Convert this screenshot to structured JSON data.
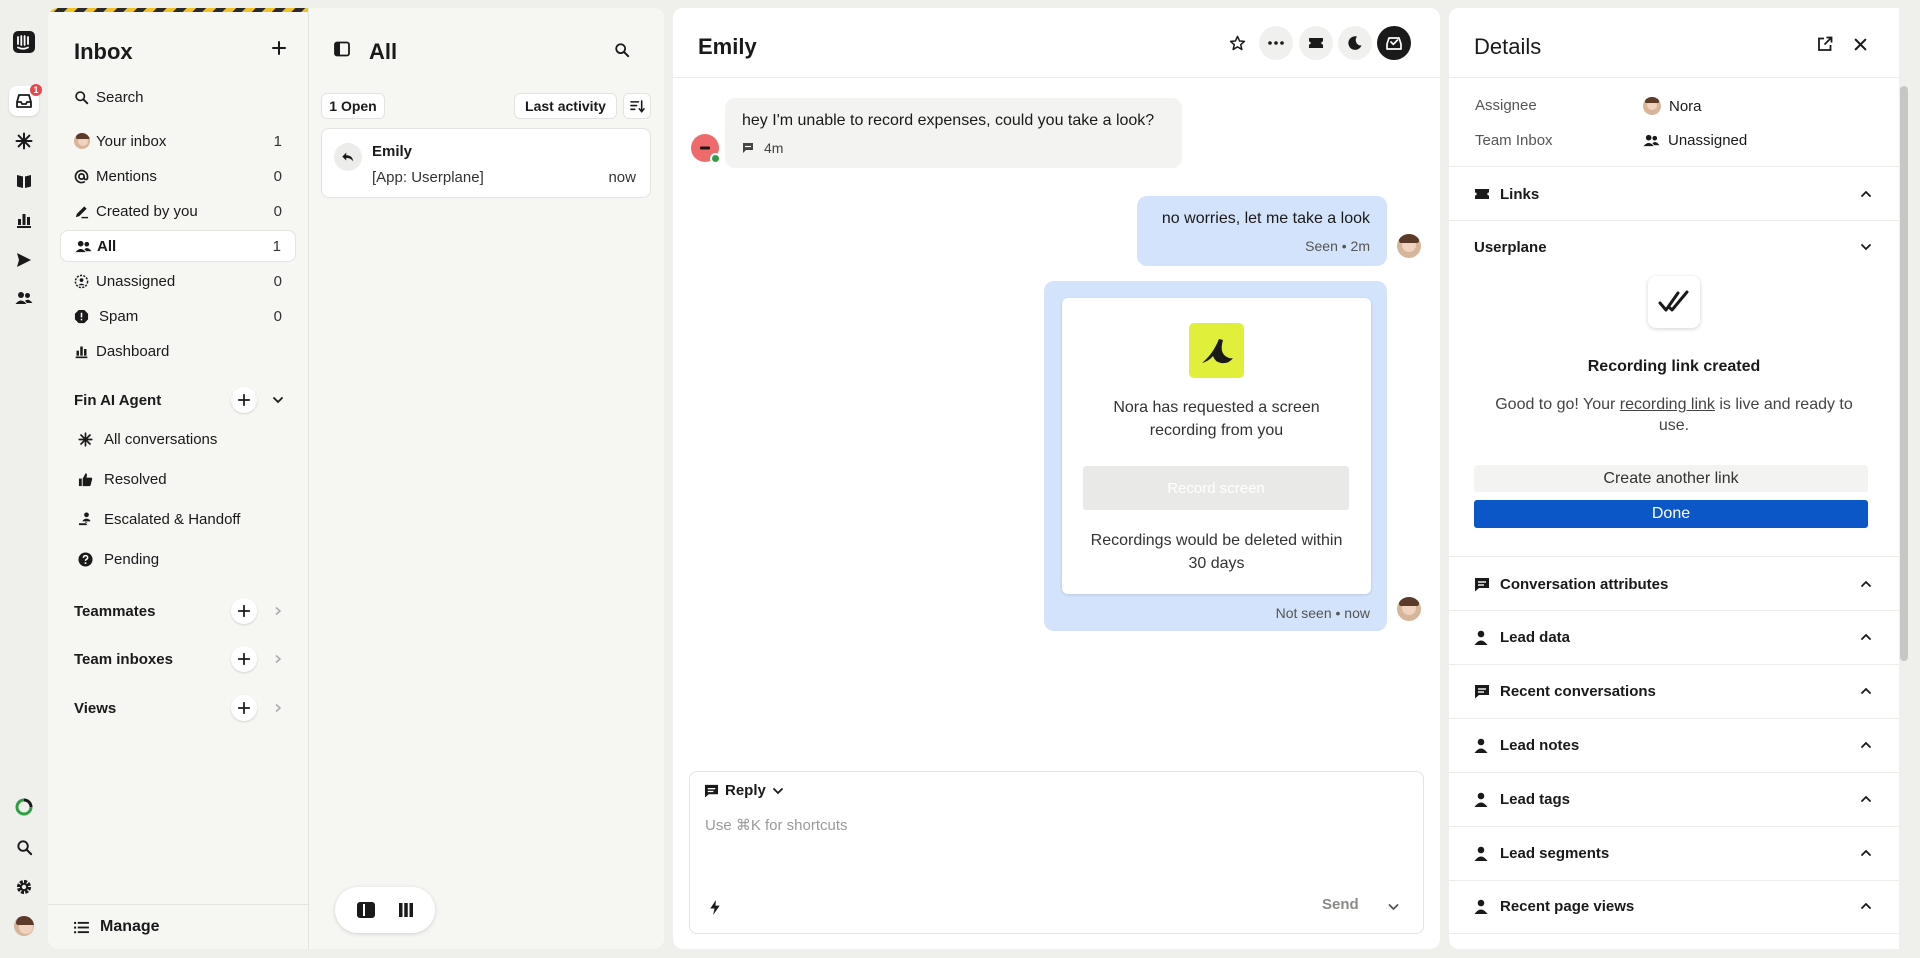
{
  "rail": {
    "inbox_badge": "1"
  },
  "inbox_nav": {
    "title": "Inbox",
    "search_label": "Search",
    "items": [
      {
        "label": "Your inbox",
        "count": "1"
      },
      {
        "label": "Mentions",
        "count": "0"
      },
      {
        "label": "Created by you",
        "count": "0"
      },
      {
        "label": "All",
        "count": "1"
      },
      {
        "label": "Unassigned",
        "count": "0"
      },
      {
        "label": "Spam",
        "count": "0"
      },
      {
        "label": "Dashboard",
        "count": ""
      }
    ],
    "fin_section": "Fin AI Agent",
    "fin_items": [
      "All conversations",
      "Resolved",
      "Escalated & Handoff",
      "Pending"
    ],
    "teammates": "Teammates",
    "team_inboxes": "Team inboxes",
    "views": "Views",
    "manage": "Manage"
  },
  "conv_list": {
    "title": "All",
    "open_filter": "1 Open",
    "sort_label": "Last activity",
    "conversations": [
      {
        "name": "Emily",
        "preview": "[App: Userplane]",
        "time": "now"
      }
    ]
  },
  "chat": {
    "title": "Emily",
    "incoming": {
      "text": "hey I'm unable to record expenses, could you take a look?",
      "time": "4m"
    },
    "outgoing": {
      "text": "no worries, let me take a look",
      "meta": "Seen • 2m"
    },
    "card": {
      "message": "Nora has requested a screen recording from you",
      "button": "Record screen",
      "note": "Recordings would be deleted within 30 days",
      "meta": "Not seen • now"
    },
    "composer": {
      "mode": "Reply",
      "placeholder": "Use ⌘K for shortcuts",
      "send": "Send"
    }
  },
  "details": {
    "title": "Details",
    "assignee_label": "Assignee",
    "assignee_value": "Nora",
    "team_label": "Team Inbox",
    "team_value": "Unassigned",
    "links": "Links",
    "userplane": "Userplane",
    "rl_title": "Recording link created",
    "rl_pre": "Good to go! Your ",
    "rl_link": "recording link",
    "rl_post": " is live and ready to use.",
    "create_another": "Create another link",
    "done": "Done",
    "sections": [
      "Conversation attributes",
      "Lead data",
      "Recent conversations",
      "Lead notes",
      "Lead tags",
      "Lead segments",
      "Recent page views"
    ]
  },
  "colors": {
    "accent": "#0c57c7",
    "bubble_out": "#d3e3fb",
    "logo": "#e0ef3a"
  }
}
